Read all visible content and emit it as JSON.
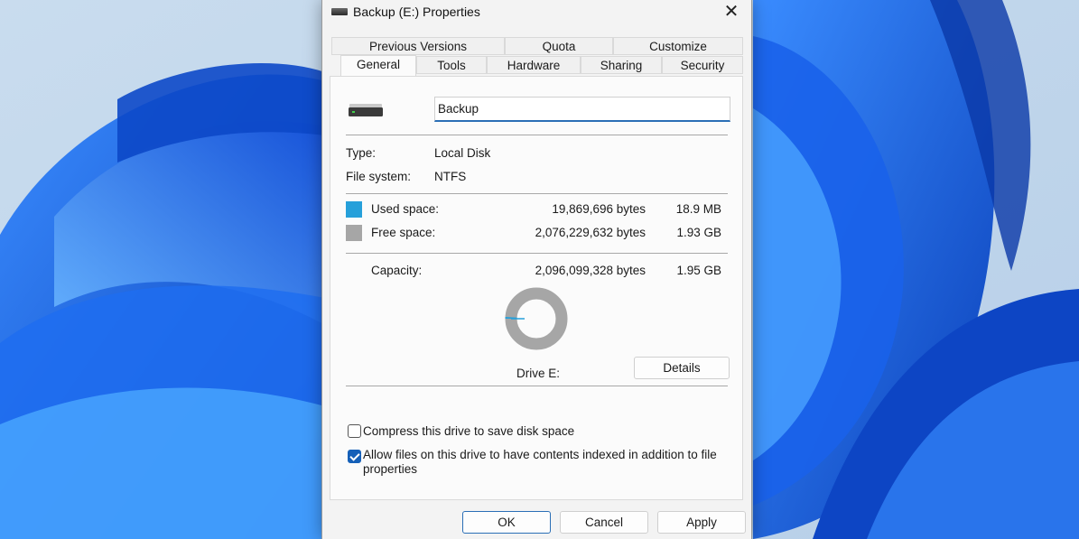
{
  "window": {
    "title": "Backup (E:) Properties",
    "close_glyph": "✕"
  },
  "tabs_row1": [
    "Previous Versions",
    "Quota",
    "Customize"
  ],
  "tabs_row2": [
    "General",
    "Tools",
    "Hardware",
    "Sharing",
    "Security"
  ],
  "active_tab": "General",
  "general": {
    "name_value": "Backup",
    "type_label": "Type:",
    "type_value": "Local Disk",
    "fs_label": "File system:",
    "fs_value": "NTFS",
    "used_label": "Used space:",
    "used_bytes": "19,869,696 bytes",
    "used_size": "18.9 MB",
    "free_label": "Free space:",
    "free_bytes": "2,076,229,632 bytes",
    "free_size": "1.93 GB",
    "capacity_label": "Capacity:",
    "capacity_bytes": "2,096,099,328 bytes",
    "capacity_size": "1.95 GB",
    "drive_label": "Drive E:",
    "details_button": "Details",
    "used_fraction": 0.0095,
    "compress_label": "Compress this drive to save disk space",
    "compress_checked": false,
    "index_label_line1": "Allow files on this drive to have contents indexed in addition to file",
    "index_label_line2": "properties",
    "index_checked": true
  },
  "buttons": {
    "ok": "OK",
    "cancel": "Cancel",
    "apply": "Apply"
  },
  "colors": {
    "used": "#26a0da",
    "free": "#a6a6a6",
    "accent": "#2b6fb6",
    "wallpaper_blue": "#1460e0"
  }
}
